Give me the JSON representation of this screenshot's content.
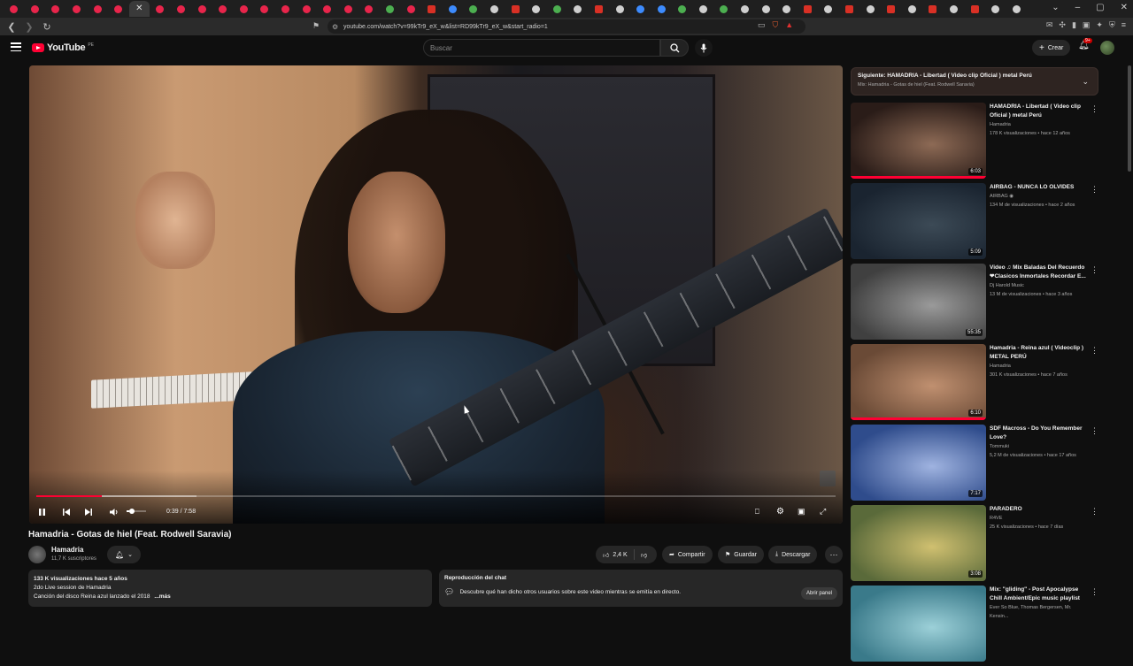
{
  "browser": {
    "tabs": [
      "yt",
      "yt",
      "yt",
      "yt",
      "yt",
      "yt",
      "active",
      "yt",
      "yt",
      "yt",
      "yt",
      "yt",
      "yt",
      "yt",
      "yt",
      "yt",
      "yt",
      "yt",
      "g",
      "yt",
      "gm",
      "b",
      "g",
      "w",
      "gm",
      "w",
      "g",
      "w",
      "gm",
      "w",
      "b",
      "b",
      "g",
      "w",
      "g",
      "w",
      "w",
      "w",
      "gm",
      "w",
      "gm",
      "w",
      "gm",
      "w",
      "gm",
      "w",
      "gm",
      "w",
      "w"
    ],
    "close_tab_glyph": "✕",
    "url": "youtube.com/watch?v=99kTr9_eX_w&list=RD99kTr9_eX_w&start_radio=1",
    "window_controls": [
      "⌄",
      "–",
      "▢",
      "✕"
    ]
  },
  "header": {
    "logo_text": "YouTube",
    "country": "PE",
    "search_placeholder": "Buscar",
    "create_label": "Crear",
    "notifications_badge": "9+"
  },
  "player": {
    "time": "0:39 / 7:58",
    "progress": 0.082,
    "buffered": 0.2,
    "volume": 0.15
  },
  "video": {
    "title": "Hamadria - Gotas de hiel (Feat. Rodwell Saravia)",
    "channel": "Hamadria",
    "subscribers": "11,7 K suscriptores",
    "likes": "2,4 K",
    "share_label": "Compartir",
    "save_label": "Guardar",
    "download_label": "Descargar",
    "description": {
      "stats": "133 K visualizaciones  hace 5 años",
      "line1": "2do Live session de Hamadria",
      "line2": "Canción del disco Reina azul lanzado el 2018",
      "more": "...más"
    },
    "chat_replay": {
      "title": "Reproducción del chat",
      "text": "Descubre qué han dicho otros usuarios sobre este video mientras se emitía en directo.",
      "button": "Abrir panel"
    }
  },
  "up_next": {
    "title": "Siguiente: HAMADRIA - Libertad ( Video clip Oficial ) metal Perú",
    "subtitle": "Mix: Hamadria - Gotas de hiel (Feat. Rodwell Saravia)"
  },
  "recommendations": [
    {
      "title": "HAMADRIA - Libertad ( Video clip Oficial ) metal Perú",
      "channel": "Hamadria",
      "meta": "178 K visualizaciones • hace 12 años",
      "duration": "6:03",
      "watched": true,
      "colors": [
        "#2a1c18",
        "#8d6a55"
      ]
    },
    {
      "title": "AIRBAG - NUNCA LO OLVIDES",
      "channel": "AIRBAG ◉",
      "meta": "134 M de visualizaciones • hace 2 años",
      "duration": "5:09",
      "watched": false,
      "colors": [
        "#1a2430",
        "#3c4a56"
      ]
    },
    {
      "title": "Video ♫ Mix Baladas Del Recuerdo ❤Clasicos Inmortales Recordar E...",
      "channel": "Dj Harold Music",
      "meta": "13 M de visualizaciones • hace 3 años",
      "duration": "55:35",
      "watched": false,
      "colors": [
        "#404040",
        "#9a9a9a"
      ]
    },
    {
      "title": "Hamadria - Reina azul ( Videoclip ) METAL PERÚ",
      "channel": "Hamadria",
      "meta": "301 K visualizaciones • hace 7 años",
      "duration": "6:10",
      "watched": true,
      "colors": [
        "#6a4a36",
        "#c09070"
      ]
    },
    {
      "title": "SDF Macross - Do You Remember Love?",
      "channel": "Tommuki",
      "meta": "5,2 M de visualizaciones • hace 17 años",
      "duration": "7:17",
      "watched": false,
      "colors": [
        "#2f4c8c",
        "#9fb3e0"
      ]
    },
    {
      "title": "PARADERO",
      "channel": "R4VE",
      "meta": "25 K visualizaciones • hace 7 días",
      "duration": "3:08",
      "watched": false,
      "colors": [
        "#5a6a3a",
        "#d0c070"
      ]
    },
    {
      "title": "Mix: \"gliding\" - Post Apocalypse Chill Ambient/Epic music playlist",
      "channel": "Ever So Blue, Thomas Bergersen, Mr. Kensin...",
      "meta": "",
      "duration": "",
      "watched": false,
      "colors": [
        "#3a7a8a",
        "#9cd0d8"
      ]
    }
  ]
}
